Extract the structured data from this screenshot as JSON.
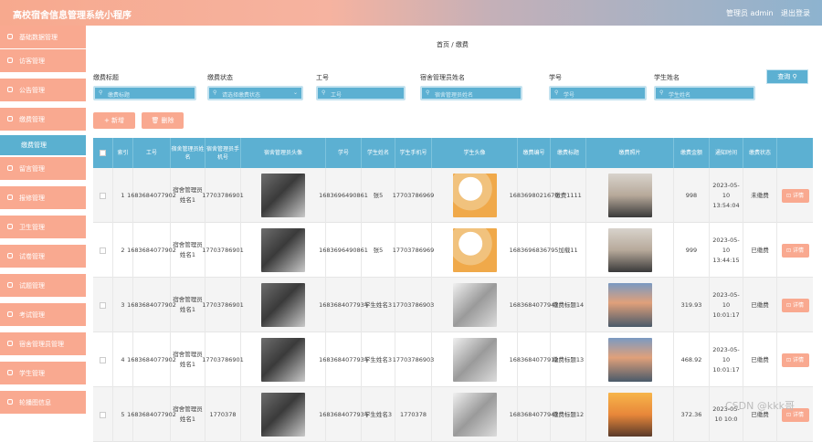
{
  "header": {
    "title": "高校宿舍信息管理系统小程序",
    "user": "管理员 admin",
    "logout": "退出登录"
  },
  "sidebar": {
    "items": [
      {
        "label": "基础数据管理"
      },
      {
        "label": "访客管理"
      },
      {
        "label": "公告管理"
      },
      {
        "label": "缴费管理"
      },
      {
        "label": "缴费管理",
        "sub": true
      },
      {
        "label": "留言管理"
      },
      {
        "label": "报修管理"
      },
      {
        "label": "卫生管理"
      },
      {
        "label": "试卷管理"
      },
      {
        "label": "试题管理"
      },
      {
        "label": "考试管理"
      },
      {
        "label": "宿舍管理员管理"
      },
      {
        "label": "学生管理"
      },
      {
        "label": "轮播图信息"
      }
    ]
  },
  "breadcrumb": {
    "home": "首页",
    "sep": "/",
    "current": "缴费"
  },
  "filters": [
    {
      "label": "缴费标题",
      "placeholder": "缴费标题"
    },
    {
      "label": "缴费状态",
      "placeholder": "请选择缴费状态"
    },
    {
      "label": "工号",
      "placeholder": "工号"
    },
    {
      "label": "宿舍管理员姓名",
      "placeholder": "宿舍管理员姓名"
    },
    {
      "label": "学号",
      "placeholder": "学号"
    },
    {
      "label": "学生姓名",
      "placeholder": "学生姓名"
    }
  ],
  "search_button": "查询",
  "actions": {
    "add": "+ 新增",
    "delete": "删除"
  },
  "table": {
    "headers": [
      "",
      "索引",
      "工号",
      "宿舍管理员姓名",
      "宿舍管理员手机号",
      "宿舍管理员头像",
      "学号",
      "学生姓名",
      "学生手机号",
      "学生头像",
      "缴费编号",
      "缴费标题",
      "缴费照片",
      "缴费金额",
      "通知时间",
      "缴费状态",
      ""
    ],
    "rows": [
      {
        "idx": "1",
        "gonghao": "1683684077902",
        "mgr_name": "宿舍管理员姓名1",
        "mgr_phone": "17703786901",
        "xuehao": "1683696490861",
        "stu_name": "张5",
        "stu_phone": "17703786969",
        "bianhao": "1683698021679",
        "biaoti": "缴费1111",
        "jine": "998",
        "time": "2023-05-10 13:54:04",
        "status": "未缴费",
        "detail": "详情"
      },
      {
        "idx": "2",
        "gonghao": "1683684077902",
        "mgr_name": "宿舍管理员姓名1",
        "mgr_phone": "17703786901",
        "xuehao": "1683696490861",
        "stu_name": "张5",
        "stu_phone": "17703786969",
        "bianhao": "1683696836795",
        "biaoti": "加载11",
        "jine": "999",
        "time": "2023-05-10 13:44:15",
        "status": "已缴费",
        "detail": "详情"
      },
      {
        "idx": "3",
        "gonghao": "1683684077902",
        "mgr_name": "宿舍管理员姓名1",
        "mgr_phone": "17703786901",
        "xuehao": "1683684077934",
        "stu_name": "学生姓名3",
        "stu_phone": "17703786903",
        "bianhao": "1683684077947",
        "biaoti": "缴费标题14",
        "jine": "319.93",
        "time": "2023-05-10 10:01:17",
        "status": "已缴费",
        "detail": "详情"
      },
      {
        "idx": "4",
        "gonghao": "1683684077902",
        "mgr_name": "宿舍管理员姓名1",
        "mgr_phone": "17703786901",
        "xuehao": "1683684077934",
        "stu_name": "学生姓名3",
        "stu_phone": "17703786903",
        "bianhao": "1683684077912",
        "biaoti": "缴费标题13",
        "jine": "468.92",
        "time": "2023-05-10 10:01:17",
        "status": "已缴费",
        "detail": "详情"
      },
      {
        "idx": "5",
        "gonghao": "1683684077902",
        "mgr_name": "宿舍管理员姓名1",
        "mgr_phone": "1770378",
        "xuehao": "1683684077934",
        "stu_name": "学生姓名3",
        "stu_phone": "1770378",
        "bianhao": "1683684077947",
        "biaoti": "缴费标题12",
        "jine": "372.36",
        "time": "2023-05-10 10:0",
        "status": "已缴费",
        "detail": "详情"
      }
    ]
  },
  "watermark": "CSDN @kkk哥"
}
